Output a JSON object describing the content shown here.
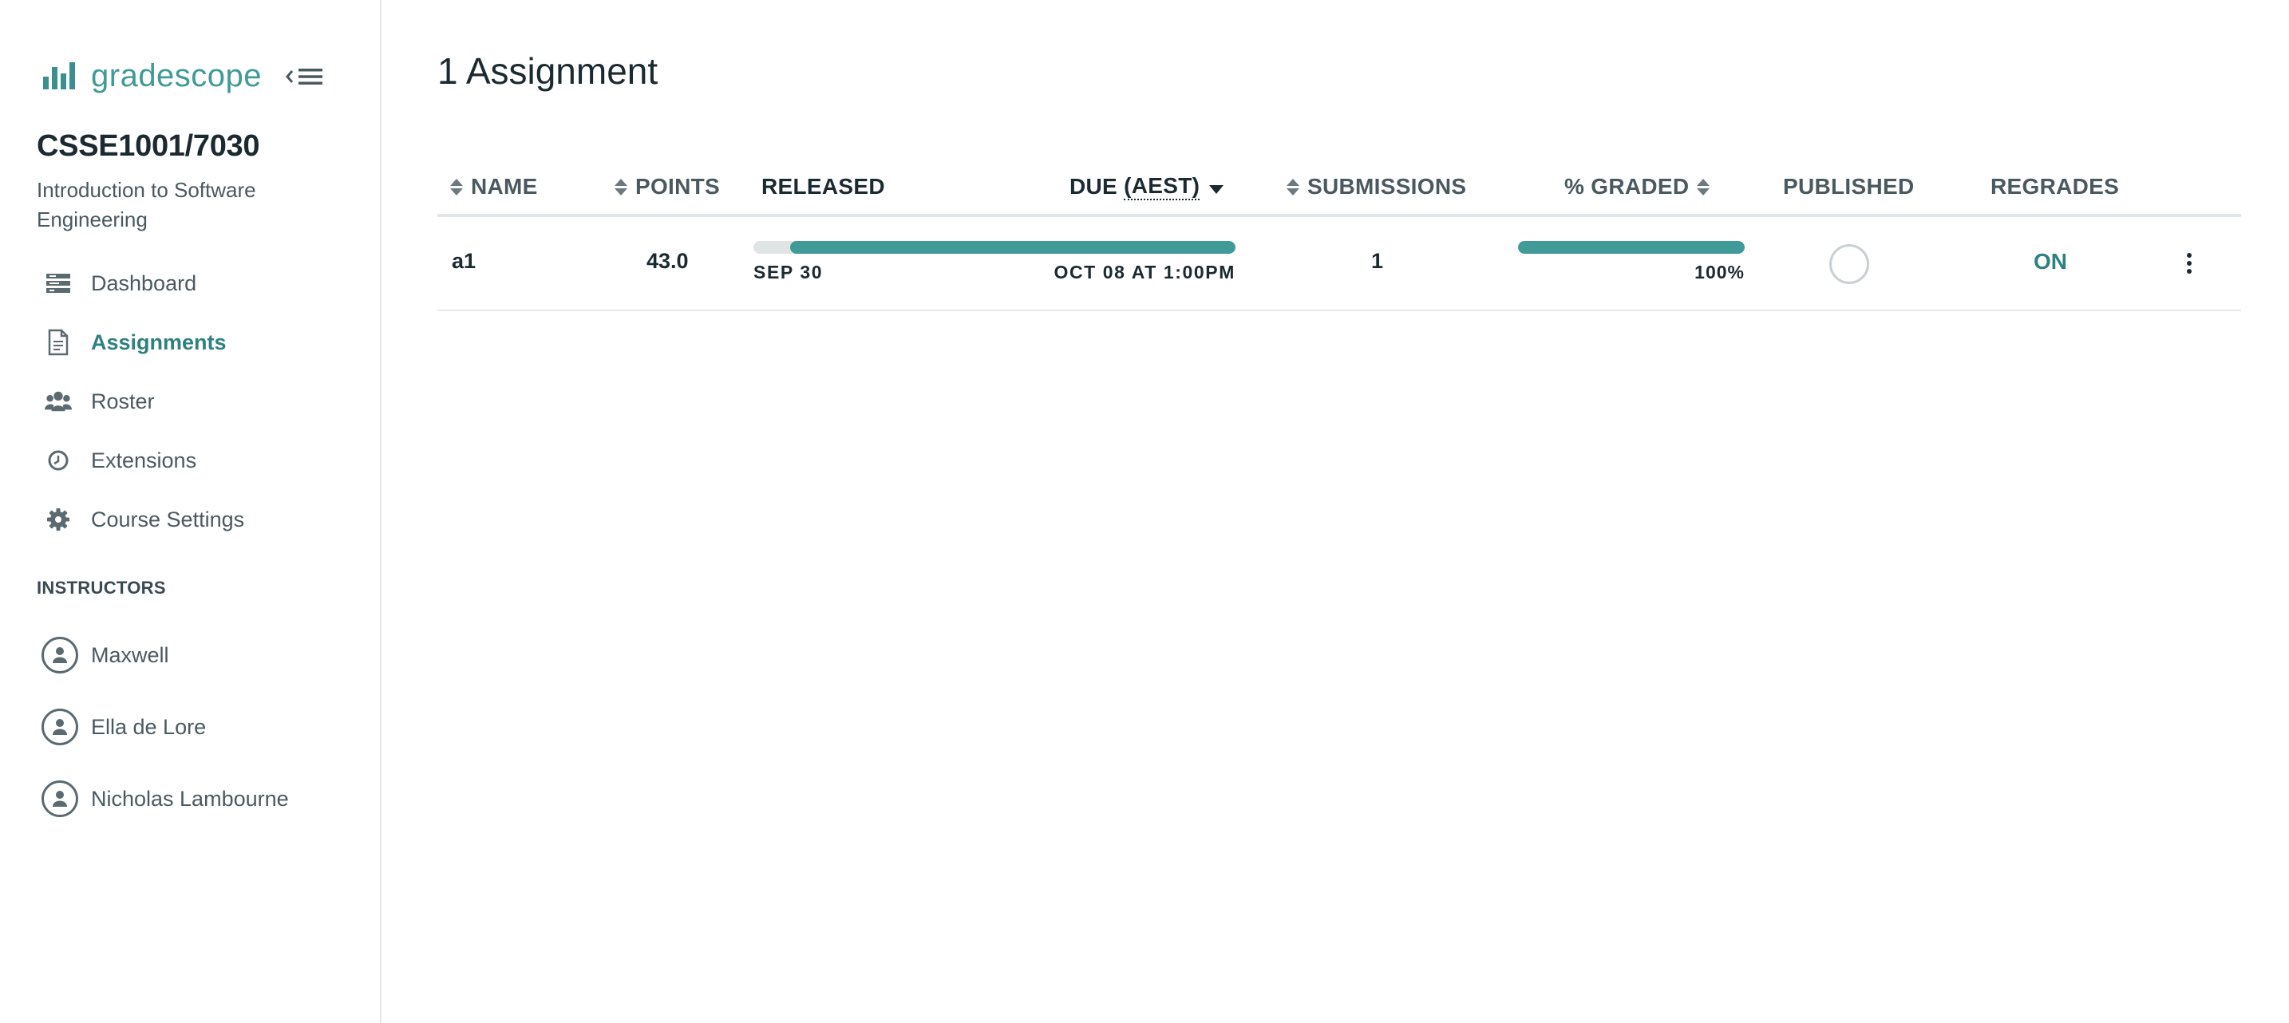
{
  "app": {
    "brand": "gradescope",
    "accent_color": "#3f9a98"
  },
  "sidebar": {
    "course_code": "CSSE1001/7030",
    "course_name": "Introduction to Software Engineering",
    "nav": [
      {
        "label": "Dashboard",
        "icon": "dashboard-icon",
        "active": false
      },
      {
        "label": "Assignments",
        "icon": "document-icon",
        "active": true
      },
      {
        "label": "Roster",
        "icon": "people-icon",
        "active": false
      },
      {
        "label": "Extensions",
        "icon": "clock-icon",
        "active": false
      },
      {
        "label": "Course Settings",
        "icon": "gear-icon",
        "active": false
      }
    ],
    "instructors_label": "INSTRUCTORS",
    "instructors": [
      {
        "name": "Maxwell"
      },
      {
        "name": "Ella de Lore"
      },
      {
        "name": "Nicholas Lambourne"
      }
    ]
  },
  "main": {
    "title": "1 Assignment",
    "columns": {
      "name": "NAME",
      "points": "POINTS",
      "released": "RELEASED",
      "due_prefix": "DUE",
      "due_tz": "(AEST)",
      "submissions": "SUBMISSIONS",
      "graded": "% GRADED",
      "published": "PUBLISHED",
      "regrades": "REGRADES"
    },
    "rows": [
      {
        "name": "a1",
        "points": "43.0",
        "released": "SEP 30",
        "due": "OCT 08 AT 1:00PM",
        "submissions": "1",
        "graded_pct": "100%",
        "graded_fraction": 1.0,
        "published": false,
        "regrades": "ON"
      }
    ]
  }
}
